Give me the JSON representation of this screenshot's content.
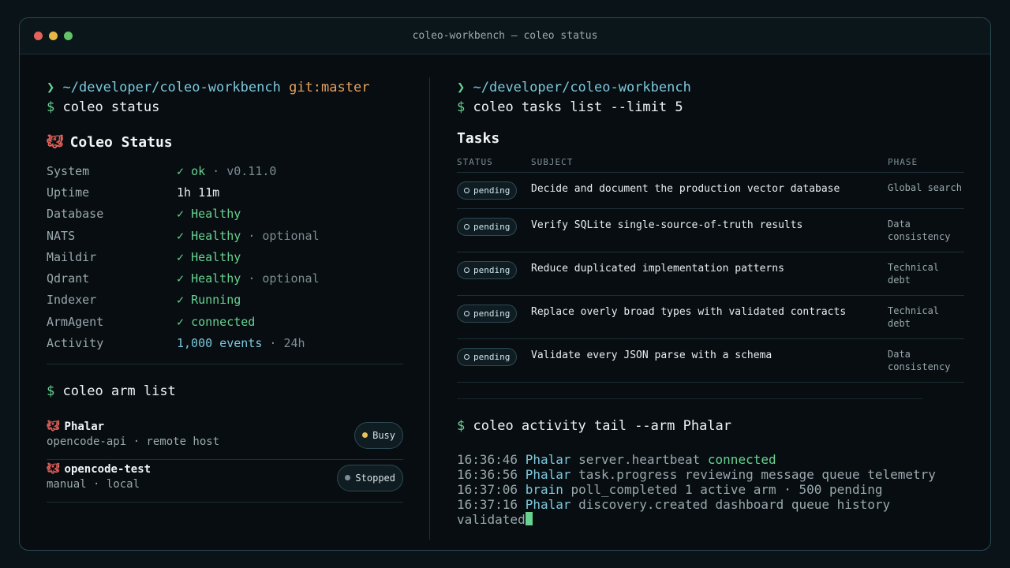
{
  "window": {
    "title": "coleo-workbench — coleo status"
  },
  "left": {
    "prompt": {
      "chevron": "❯",
      "path": "~/developer/coleo-workbench",
      "git": "git:master",
      "dollar": "$",
      "command": "coleo status"
    },
    "status_title": "Coleo Status",
    "status_rows": [
      {
        "key": "System",
        "check": "✓",
        "value": "ok",
        "extra": "· v0.11.0"
      },
      {
        "key": "Uptime",
        "check": "",
        "value": "1h 11m",
        "extra": ""
      },
      {
        "key": "Database",
        "check": "✓",
        "value": "Healthy",
        "extra": ""
      },
      {
        "key": "NATS",
        "check": "✓",
        "value": "Healthy",
        "extra": "· optional"
      },
      {
        "key": "Maildir",
        "check": "✓",
        "value": "Healthy",
        "extra": ""
      },
      {
        "key": "Qdrant",
        "check": "✓",
        "value": "Healthy",
        "extra": "· optional"
      },
      {
        "key": "Indexer",
        "check": "✓",
        "value": "Running",
        "extra": ""
      },
      {
        "key": "ArmAgent",
        "check": "✓",
        "value": "connected",
        "extra": ""
      },
      {
        "key": "Activity",
        "check": "",
        "value": "1,000 events",
        "extra": "· 24h"
      }
    ],
    "arm_command": {
      "dollar": "$",
      "command": "coleo arm list"
    },
    "arms": [
      {
        "name": "Phalar",
        "sub": "opencode-api · remote host",
        "status": "Busy",
        "status_color": "#e8c15a"
      },
      {
        "name": "opencode-test",
        "sub": "manual · local",
        "status": "Stopped",
        "status_color": "#7d8d93"
      }
    ]
  },
  "right": {
    "prompt": {
      "chevron": "❯",
      "path": "~/developer/coleo-workbench",
      "dollar": "$",
      "command": "coleo tasks list --limit 5"
    },
    "tasks_title": "Tasks",
    "columns": {
      "status": "STATUS",
      "subject": "SUBJECT",
      "phase": "PHASE"
    },
    "tasks": [
      {
        "status": "pending",
        "subject": "Decide and document the production vector database",
        "phase_1": "Global search",
        "phase_2": ""
      },
      {
        "status": "pending",
        "subject": "Verify SQLite single-source-of-truth results",
        "phase_1": "Data",
        "phase_2": "consistency"
      },
      {
        "status": "pending",
        "subject": "Reduce duplicated implementation patterns",
        "phase_1": "Technical",
        "phase_2": "debt"
      },
      {
        "status": "pending",
        "subject": "Replace overly broad types with validated contracts",
        "phase_1": "Technical",
        "phase_2": "debt"
      },
      {
        "status": "pending",
        "subject": "Validate every JSON parse with a schema",
        "phase_1": "Data",
        "phase_2": "consistency"
      }
    ],
    "activity_command": {
      "dollar": "$",
      "command": "coleo activity tail --arm Phalar"
    },
    "activity": [
      {
        "time": "16:36:46",
        "actor": "Phalar",
        "event": "server.heartbeat",
        "detail": "connected"
      },
      {
        "time": "16:36:56",
        "actor": "Phalar",
        "event": "task.progress",
        "detail": "reviewing message queue telemetry"
      },
      {
        "time": "16:37:06",
        "actor": "brain",
        "event": "poll_completed",
        "detail": "1 active arm · 500 pending"
      },
      {
        "time": "16:37:16",
        "actor": "Phalar",
        "event": "discovery.created",
        "detail": "dashboard queue history"
      }
    ],
    "activity_tail": "validated"
  },
  "colors": {
    "accent_green": "#68d391",
    "accent_blue": "#7cc8dc",
    "git_orange": "#e7a25d"
  }
}
